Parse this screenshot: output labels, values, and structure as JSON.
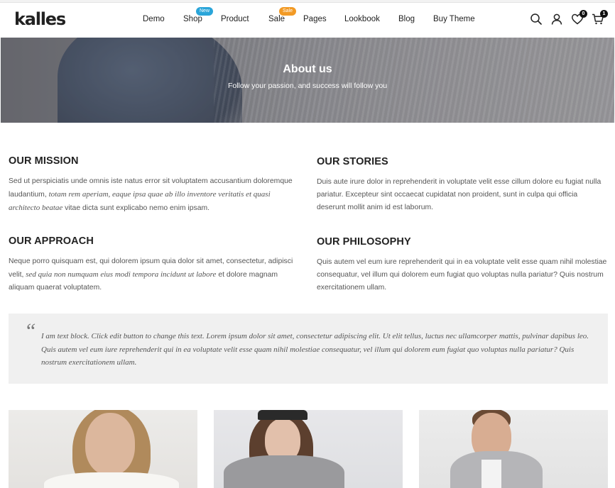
{
  "header": {
    "logo": "kalles",
    "nav": [
      {
        "label": "Demo",
        "badge": ""
      },
      {
        "label": "Shop",
        "badge": "New"
      },
      {
        "label": "Product",
        "badge": ""
      },
      {
        "label": "Sale",
        "badge": "Sale"
      },
      {
        "label": "Pages",
        "badge": ""
      },
      {
        "label": "Lookbook",
        "badge": ""
      },
      {
        "label": "Blog",
        "badge": ""
      },
      {
        "label": "Buy Theme",
        "badge": ""
      }
    ],
    "icons": {
      "search": "search-icon",
      "account": "user-icon",
      "wishlist": "heart-icon",
      "cart": "cart-icon"
    },
    "wishlist_count": "0",
    "cart_count": "1"
  },
  "hero": {
    "title": "About us",
    "subtitle": "Follow your passion, and success will follow you"
  },
  "sections": {
    "mission": {
      "title": "OUR MISSION",
      "text_a": "Sed ut perspiciatis unde omnis iste natus error sit voluptatem accusantium doloremque laudantium, ",
      "text_em": "totam rem aperiam, eaque ipsa quae ab illo inventore veritatis et quasi architecto beatae",
      "text_b": " vitae dicta sunt explicabo nemo enim ipsam."
    },
    "stories": {
      "title": "OUR STORIES",
      "text": "Duis aute irure dolor in reprehenderit in voluptate velit esse cillum dolore eu fugiat nulla pariatur. Excepteur sint occaecat cupidatat non proident, sunt in culpa qui officia deserunt mollit anim id est laborum."
    },
    "approach": {
      "title": "OUR APPROACH",
      "text_a": "Neque porro quisquam est, qui dolorem ipsum quia dolor sit amet, consectetur, adipisci velit, ",
      "text_em": "sed quia non numquam eius modi tempora incidunt ut labore",
      "text_b": " et dolore magnam aliquam quaerat voluptatem."
    },
    "philosophy": {
      "title": "OUR PHILOSOPHY",
      "text": "Quis autem vel eum iure reprehenderit qui in ea voluptate velit esse quam nihil molestiae consequatur, vel illum qui dolorem eum fugiat quo voluptas nulla pariatur? Quis nostrum exercitationem ullam."
    }
  },
  "quote": {
    "mark": "“",
    "text": "I am text block. Click edit button to change this text. Lorem ipsum dolor sit amet, consectetur adipiscing elit. Ut elit tellus, luctus nec ullamcorper mattis, pulvinar dapibus leo. Quis autem vel eum iure reprehenderit qui in ea voluptate velit esse quam nihil molestiae consequatur, vel illum qui dolorem eum fugiat quo voluptas nulla pariatur? Quis nostrum exercitationem ullam."
  },
  "colors": {
    "badge_new": "#2aa5d9",
    "badge_sale": "#f29a24",
    "quote_bg": "#f0f0f0",
    "text_dark": "#222222",
    "text_body": "#555555"
  }
}
